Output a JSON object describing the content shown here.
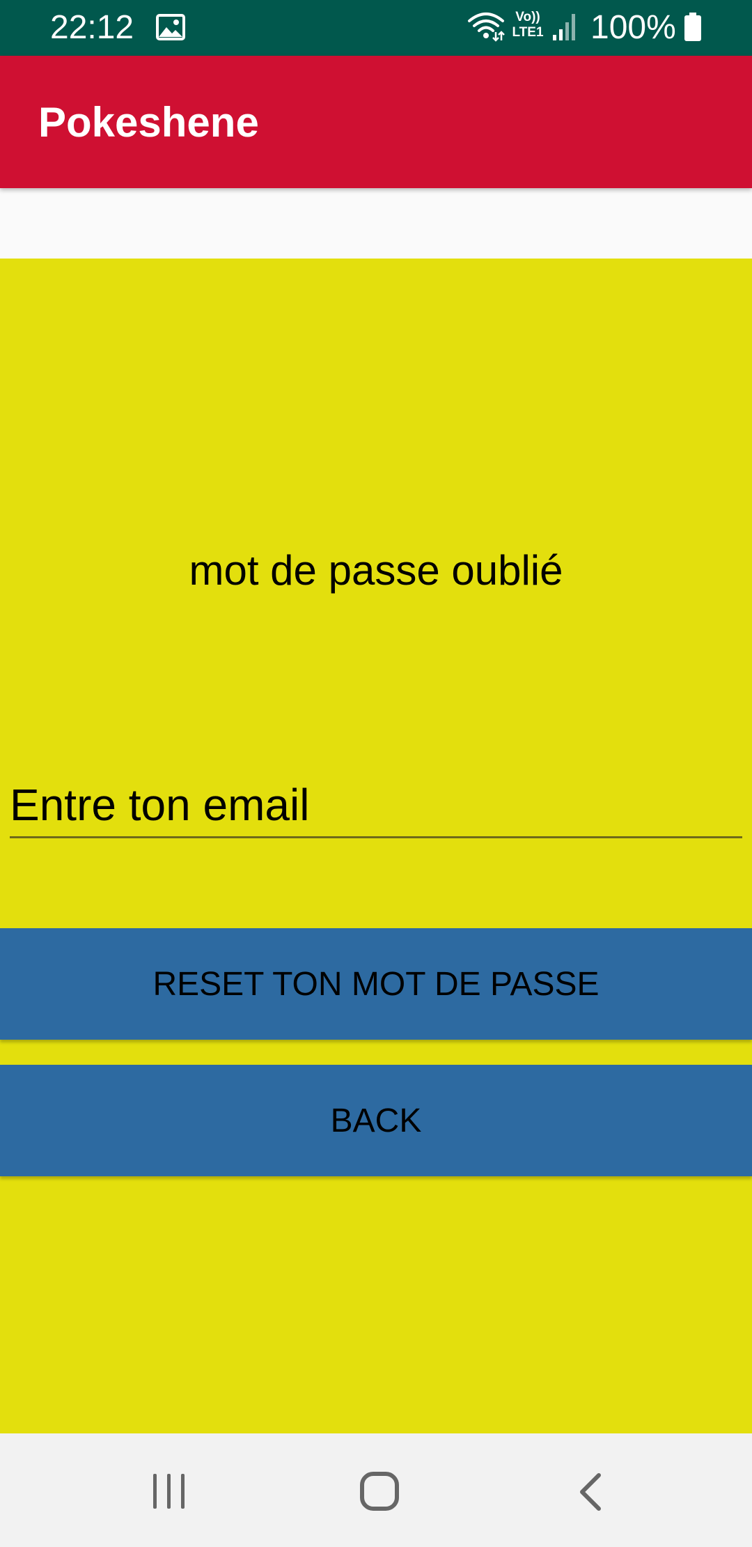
{
  "status_bar": {
    "time": "22:12",
    "network_label_line1": "Vo))",
    "network_label_line2": "LTE1",
    "battery_percent": "100%",
    "icons": [
      "gallery-icon",
      "wifi-icon",
      "lte-icon",
      "signal-icon",
      "battery-icon"
    ]
  },
  "app_bar": {
    "title": "Pokeshene",
    "color": "#cf1032"
  },
  "main": {
    "background": "#e3df0d",
    "heading": "mot de passe oublié",
    "email_placeholder": "Entre ton email",
    "email_value": "",
    "reset_button_label": "RESET TON MOT DE PASSE",
    "back_button_label": "BACK",
    "button_color": "#2d6aa1"
  },
  "nav_bar": {
    "icons": [
      "recents-icon",
      "home-icon",
      "back-icon"
    ]
  }
}
